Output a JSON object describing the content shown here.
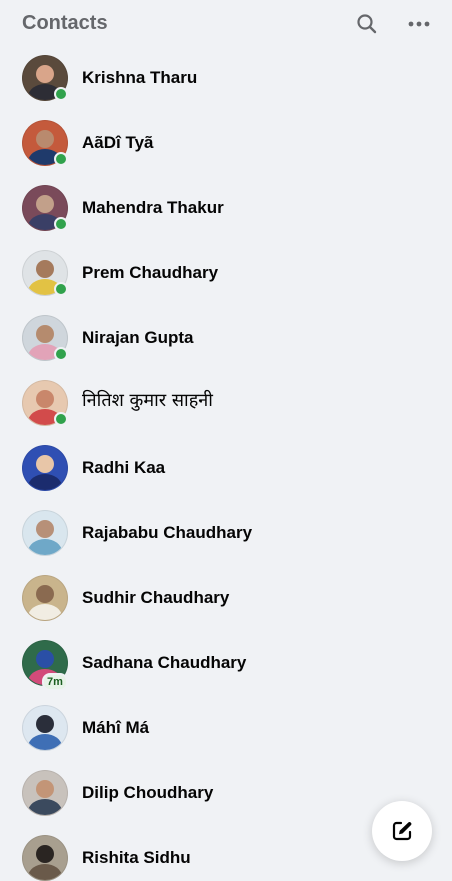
{
  "header": {
    "title": "Contacts",
    "search_icon": "search-icon",
    "more_icon": "more-options-icon"
  },
  "contacts": [
    {
      "name": "Krishna Tharu",
      "online": true,
      "badge": "",
      "avatar_colors": [
        "#5a4a3c",
        "#d9a58a",
        "#2d2d35"
      ]
    },
    {
      "name": "AãDî Tyã",
      "online": true,
      "badge": "",
      "avatar_colors": [
        "#c45a3c",
        "#b98a6e",
        "#1f3a6b"
      ]
    },
    {
      "name": "Mahendra Thakur",
      "online": true,
      "badge": "",
      "avatar_colors": [
        "#7a4a5a",
        "#c2a08a",
        "#3a3f66"
      ]
    },
    {
      "name": "Prem Chaudhary",
      "online": true,
      "badge": "",
      "avatar_colors": [
        "#dfe3e6",
        "#a57a5c",
        "#e2c244"
      ]
    },
    {
      "name": "Nirajan Gupta",
      "online": true,
      "badge": "",
      "avatar_colors": [
        "#cfd6dc",
        "#b58b6e",
        "#e2a3b8"
      ]
    },
    {
      "name": "नितिश कुमार साहनी",
      "online": true,
      "badge": "",
      "avatar_colors": [
        "#e7c9b0",
        "#c9876b",
        "#d24b4b"
      ]
    },
    {
      "name": "Radhi Kaa",
      "online": false,
      "badge": "",
      "avatar_colors": [
        "#2f4fb3",
        "#e8c6a8",
        "#1b2c6e"
      ]
    },
    {
      "name": "Rajababu Chaudhary",
      "online": false,
      "badge": "",
      "avatar_colors": [
        "#d9e6ee",
        "#b79078",
        "#6fa8c8"
      ]
    },
    {
      "name": "Sudhir Chaudhary",
      "online": false,
      "badge": "",
      "avatar_colors": [
        "#c9b48c",
        "#8a6a50",
        "#f1ede3"
      ]
    },
    {
      "name": "Sadhana Chaudhary",
      "online": false,
      "badge": "7m",
      "avatar_colors": [
        "#2f6b4a",
        "#2a4fa6",
        "#d24b7a"
      ]
    },
    {
      "name": "Máhî Má",
      "online": false,
      "badge": "",
      "avatar_colors": [
        "#dde7f0",
        "#2a2e3a",
        "#3f6fb5"
      ]
    },
    {
      "name": "Dilip Choudhary",
      "online": false,
      "badge": "",
      "avatar_colors": [
        "#c8c2bc",
        "#c39577",
        "#3b4a5e"
      ]
    },
    {
      "name": "Rishita Sidhu",
      "online": false,
      "badge": "",
      "avatar_colors": [
        "#a89f8f",
        "#2a2522",
        "#6a5a4a"
      ]
    }
  ],
  "compose": {
    "icon": "compose-message-icon"
  }
}
